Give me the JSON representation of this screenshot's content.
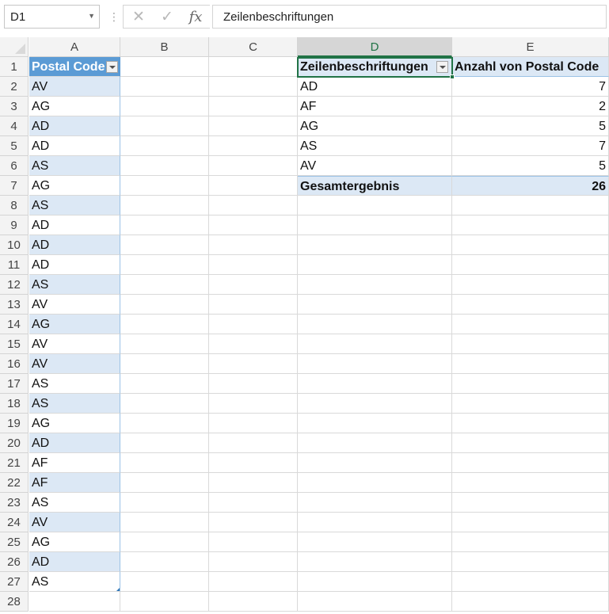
{
  "name_box": {
    "value": "D1"
  },
  "formula_bar": {
    "content": "Zeilenbeschriftungen",
    "fx_label": "fx"
  },
  "columns": [
    "A",
    "B",
    "C",
    "D",
    "E"
  ],
  "selected_column": "D",
  "rows": [
    "1",
    "2",
    "3",
    "4",
    "5",
    "6",
    "7",
    "8",
    "9",
    "10",
    "11",
    "12",
    "13",
    "14",
    "15",
    "16",
    "17",
    "18",
    "19",
    "20",
    "21",
    "22",
    "23",
    "24",
    "25",
    "26",
    "27",
    "28"
  ],
  "table": {
    "header": "Postal Code",
    "values": [
      "AV",
      "AG",
      "AD",
      "AD",
      "AS",
      "AG",
      "AS",
      "AD",
      "AD",
      "AD",
      "AS",
      "AV",
      "AG",
      "AV",
      "AV",
      "AS",
      "AS",
      "AG",
      "AD",
      "AF",
      "AF",
      "AS",
      "AV",
      "AG",
      "AD",
      "AS"
    ]
  },
  "pivot": {
    "row_label_header": "Zeilenbeschriftungen",
    "value_header": "Anzahl von Postal Code",
    "rows": [
      {
        "label": "AD",
        "count": "7"
      },
      {
        "label": "AF",
        "count": "2"
      },
      {
        "label": "AG",
        "count": "5"
      },
      {
        "label": "AS",
        "count": "7"
      },
      {
        "label": "AV",
        "count": "5"
      }
    ],
    "total_label": "Gesamtergebnis",
    "total_value": "26"
  },
  "colors": {
    "table_header": "#5b9bd5",
    "band": "#dce8f5",
    "selection": "#217346"
  }
}
